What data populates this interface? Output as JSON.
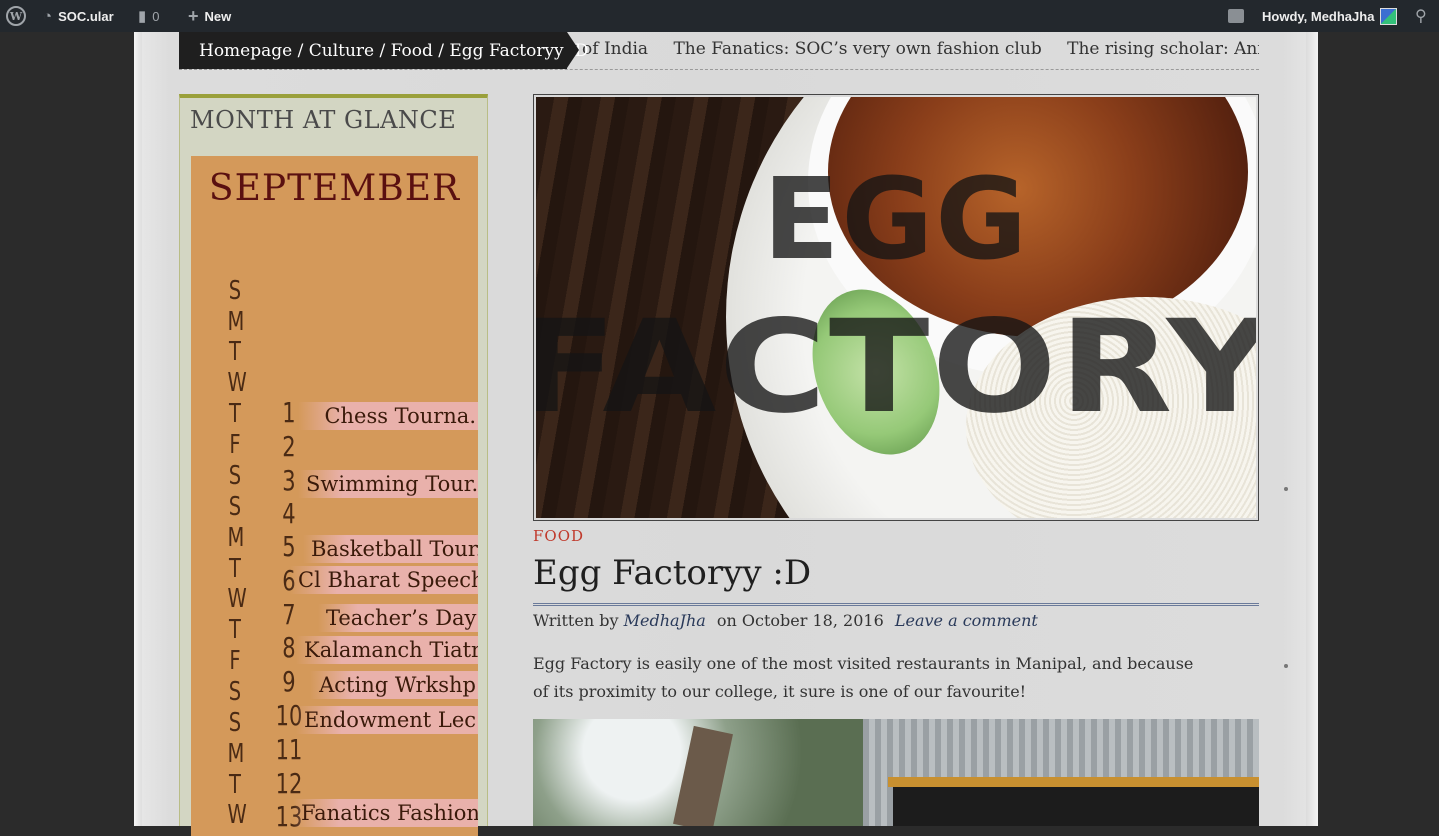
{
  "adminbar": {
    "site_name": "SOC.ular",
    "comments_count": "0",
    "new_label": "New",
    "greeting": "Howdy, MedhaJha"
  },
  "ticker": {
    "breadcrumb": "Homepage / Culture / Food / Egg Factoryy :D",
    "items": [
      "y of India",
      "The Fanatics: SOC’s very own fashion club",
      "The rising scholar: Aniruddh"
    ]
  },
  "sidebar": {
    "widget_title": "MONTH AT GLANCE",
    "calendar": {
      "month": "SEPTEMBER",
      "days_of_week": [
        "S",
        "M",
        "T",
        "W",
        "T",
        "F",
        "S",
        "S",
        "M",
        "T",
        "W",
        "T",
        "F",
        "S",
        "S",
        "M",
        "T",
        "W"
      ],
      "dates": [
        "1",
        "2",
        "3",
        "4",
        "5",
        "6",
        "7",
        "8",
        "9",
        "10",
        "11",
        "12",
        "13"
      ],
      "events": [
        "Chess Tourna.",
        "Swimming Tour.",
        "Basketball Tour.",
        "Cl Bharat Speech",
        "Teacher’s Day",
        "Kalamanch Tiatr",
        "Acting Wrkshp",
        "Endowment Lec.",
        "Fanatics Fashion"
      ]
    }
  },
  "post": {
    "hero_title_line1": "EGG",
    "hero_title_line2": "FACTORY",
    "category": "FOOD",
    "title": "Egg Factoryy :D",
    "written_by": "Written by",
    "author": "MedhaJha",
    "date_text": "on October 18, 2016",
    "comment_link": "Leave a comment",
    "excerpt": "Egg Factory is easily one of the most visited restaurants in Manipal, and because of its proximity to our college, it sure is one of our favourite!"
  }
}
